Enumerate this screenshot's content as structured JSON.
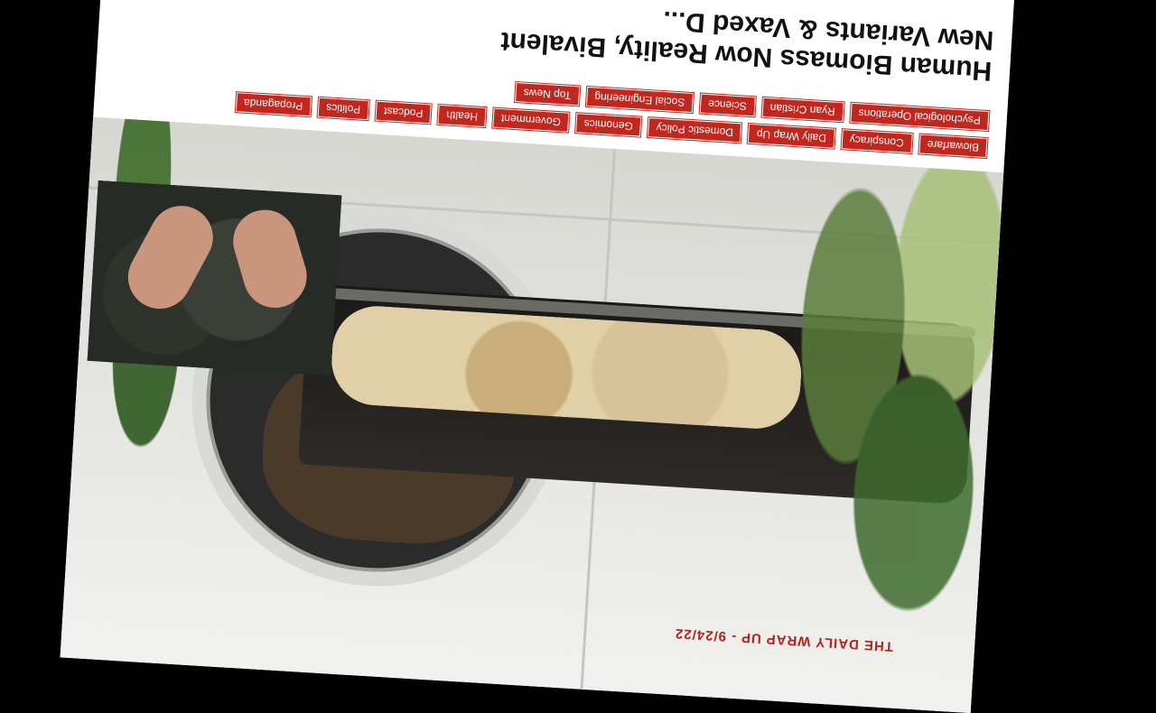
{
  "article": {
    "title_line1": "Human Biomass Now Reality, Bivalent",
    "title_line2": "New Variants & Vaxed D...",
    "tags": [
      "Biowarfare",
      "Conspiracy",
      "Daily Wrap Up",
      "Domestic Policy",
      "Genomics",
      "Government",
      "Health",
      "Podcast",
      "Politics",
      "Propaganda",
      "Psychological Operations",
      "Ryan Cristian",
      "Science",
      "Social Engineering",
      "Top News"
    ],
    "image_caption": "THE DAILY WRAP UP - 9/24/22"
  }
}
